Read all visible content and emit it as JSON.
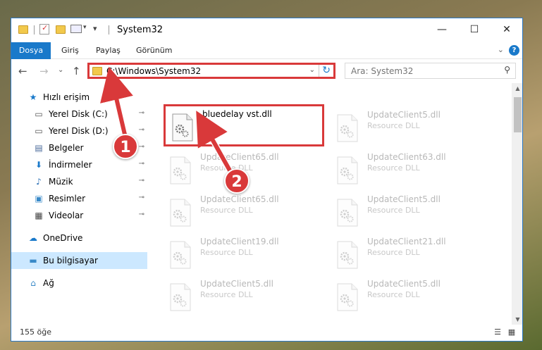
{
  "window": {
    "title": "System32",
    "minimize_symbol": "—",
    "maximize_symbol": "☐",
    "close_symbol": "✕"
  },
  "quick_access_toolbar": {
    "dropdown_symbol": "▾"
  },
  "ribbon": {
    "tabs": [
      "Dosya",
      "Giriş",
      "Paylaş",
      "Görünüm"
    ],
    "expand_symbol": "⌄",
    "help_symbol": "?",
    "file_tab_color": "#1979ca"
  },
  "navigation": {
    "back_symbol": "←",
    "forward_symbol": "→",
    "recent_symbol": "⌄",
    "up_symbol": "↑",
    "address_path": "C:\\Windows\\System32",
    "address_dropdown_symbol": "⌄",
    "refresh_symbol": "↻",
    "search_placeholder": "Ara: System32",
    "search_symbol": "⚲"
  },
  "sidebar": {
    "items": [
      {
        "label": "Hızlı erişim",
        "icon": "star-icon",
        "glyph": "★",
        "color": "#1979ca",
        "pinned": false
      },
      {
        "label": "Yerel Disk (C:)",
        "icon": "drive-icon",
        "glyph": "▭",
        "color": "#555555",
        "pinned": true
      },
      {
        "label": "Yerel Disk (D:)",
        "icon": "drive-icon",
        "glyph": "▭",
        "color": "#555555",
        "pinned": true
      },
      {
        "label": "Belgeler",
        "icon": "documents-icon",
        "glyph": "▤",
        "color": "#4a6a9a",
        "pinned": true
      },
      {
        "label": "İndirmeler",
        "icon": "download-icon",
        "glyph": "⬇",
        "color": "#1979ca",
        "pinned": true
      },
      {
        "label": "Müzik",
        "icon": "music-icon",
        "glyph": "♪",
        "color": "#2b6fb5",
        "pinned": true
      },
      {
        "label": "Resimler",
        "icon": "pictures-icon",
        "glyph": "▣",
        "color": "#3a8ac8",
        "pinned": true
      },
      {
        "label": "Videolar",
        "icon": "videos-icon",
        "glyph": "▦",
        "color": "#444444",
        "pinned": true
      },
      {
        "label": "OneDrive",
        "icon": "cloud-icon",
        "glyph": "☁",
        "color": "#1979ca",
        "pinned": false
      },
      {
        "label": "Bu bilgisayar",
        "icon": "computer-icon",
        "glyph": "▬",
        "color": "#3a8ac8",
        "pinned": false,
        "selected": true
      },
      {
        "label": "Ağ",
        "icon": "network-icon",
        "glyph": "⌂",
        "color": "#3a8ac8",
        "pinned": false
      }
    ],
    "pin_symbol": "📌"
  },
  "files": [
    {
      "name": "bluedelay vst.dll",
      "type": "",
      "highlighted": true
    },
    {
      "name": "UpdateClient5.dll",
      "type": "Resource DLL"
    },
    {
      "name": "UpdateClient65.dll",
      "type": "Resource DLL"
    },
    {
      "name": "UpdateClient63.dll",
      "type": "Resource DLL"
    },
    {
      "name": "UpdateClient65.dll",
      "type": "Resource DLL"
    },
    {
      "name": "UpdateClient5.dll",
      "type": "Resource DLL"
    },
    {
      "name": "UpdateClient19.dll",
      "type": "Resource DLL"
    },
    {
      "name": "UpdateClient21.dll",
      "type": "Resource DLL"
    },
    {
      "name": "UpdateClient5.dll",
      "type": "Resource DLL"
    },
    {
      "name": "UpdateClient5.dll",
      "type": "Resource DLL"
    }
  ],
  "status": {
    "item_count": "155 öğe"
  },
  "callouts": [
    "1",
    "2"
  ],
  "accent_red": "#d9393a"
}
